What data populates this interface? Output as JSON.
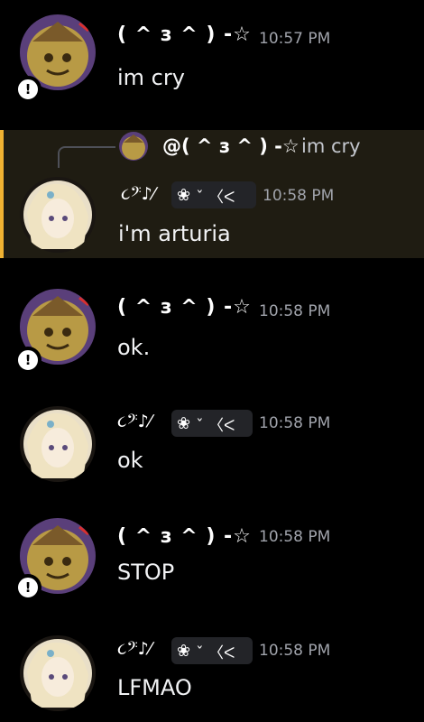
{
  "users": {
    "user_a": {
      "name": "( ^ з ^ ) -☆"
    },
    "user_b": {
      "name": "૮𝄢♪⁄",
      "tag": "ˇ 〈ᐸ"
    }
  },
  "messages": [
    {
      "author": "( ^ з ^ ) -☆",
      "time": "10:57 PM",
      "text": "im cry"
    },
    {
      "reply": {
        "mention": "@( ^ з ^ ) -☆",
        "text": "im cry"
      },
      "author": "૮𝄢♪⁄",
      "tag": "ˇ 〈ᐸ",
      "time": "10:58 PM",
      "text": "i'm arturia"
    },
    {
      "author": "( ^ з ^ ) -☆",
      "time": "10:58 PM",
      "text": "ok."
    },
    {
      "author": "૮𝄢♪⁄",
      "tag": "ˇ 〈ᐸ",
      "time": "10:58 PM",
      "text": "ok"
    },
    {
      "author": "( ^ з ^ ) -☆",
      "time": "10:58 PM",
      "text": "STOP"
    },
    {
      "author": "૮𝄢♪⁄",
      "tag": "ˇ 〈ᐸ",
      "time": "10:58 PM",
      "text": "LFMAO"
    }
  ],
  "icons": {
    "status_badge": "!",
    "flower": "❀"
  },
  "colors": {
    "background": "#000000",
    "highlight_bg": "#1f1c12",
    "highlight_bar": "#f0b232",
    "timestamp": "#a0a3ab",
    "text": "#f2f3f5"
  }
}
